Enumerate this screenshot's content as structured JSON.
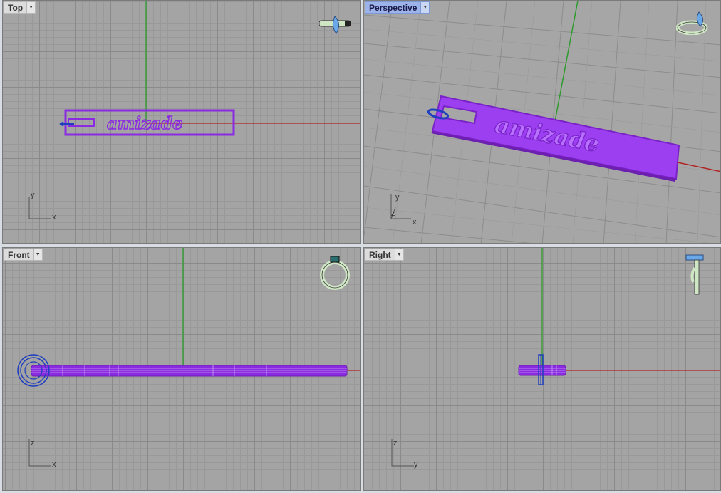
{
  "viewports": {
    "top": {
      "title": "Top"
    },
    "perspective": {
      "title": "Perspective"
    },
    "front": {
      "title": "Front"
    },
    "right": {
      "title": "Right"
    }
  },
  "model": {
    "text": "amizade"
  },
  "axes": {
    "top": {
      "h": "x",
      "v": "y"
    },
    "perspective": {
      "h": "x",
      "v": "y",
      "z": "z"
    },
    "front": {
      "h": "x",
      "v": "z"
    },
    "right": {
      "h": "y",
      "v": "z"
    }
  },
  "colors": {
    "object": "#8a2be2",
    "object_fill": "#9b3ff0",
    "x_axis": "#b22222",
    "y_axis": "#2e9b2e",
    "ring": "#1f3fbf",
    "gem": "#6aa8e8"
  },
  "icons": {
    "nav": "ring-preview-icon",
    "dropdown": "dropdown-arrow-icon"
  }
}
